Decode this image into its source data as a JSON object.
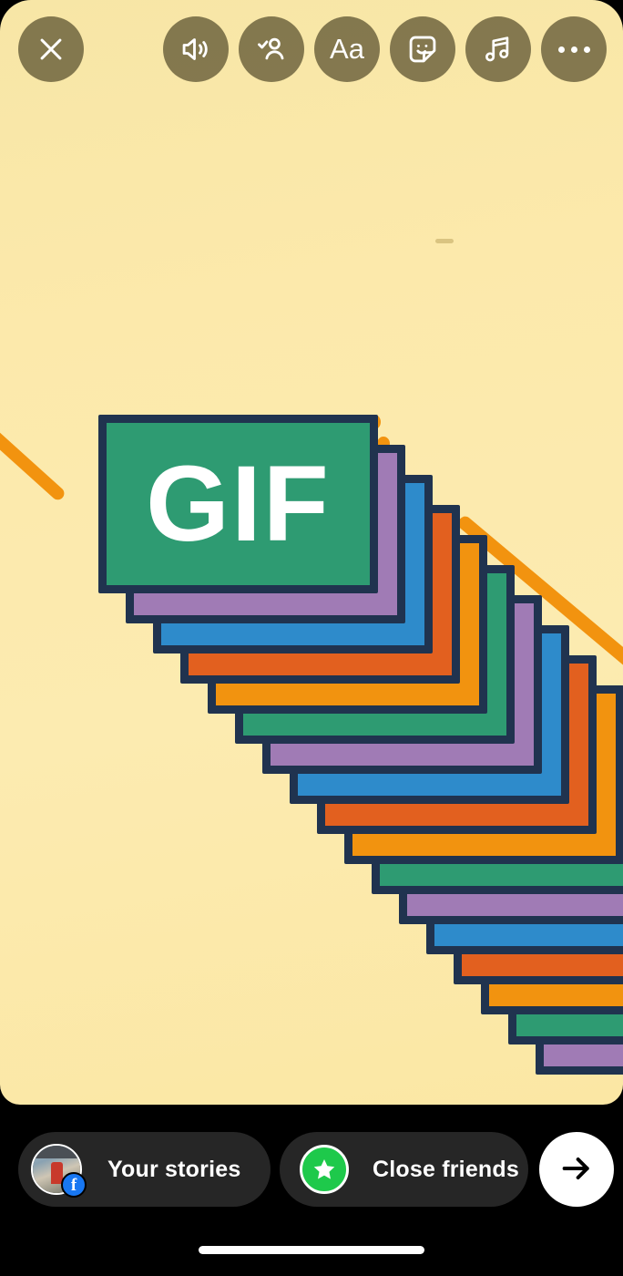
{
  "screen": {
    "app": "Instagram Stories Editor",
    "background_color": "#fbe9ab",
    "bottom_bar_color": "#000000"
  },
  "toolbar": {
    "buttons": [
      {
        "name": "close-button",
        "icon": "close-icon",
        "label": "Close"
      },
      {
        "name": "sound-button",
        "icon": "speaker-on-icon",
        "label": "Sound on"
      },
      {
        "name": "tag-people-button",
        "icon": "person-check-icon",
        "label": "Tag people"
      },
      {
        "name": "text-button",
        "icon": "text-icon",
        "label": "Aa"
      },
      {
        "name": "sticker-button",
        "icon": "sticker-icon",
        "label": "Stickers"
      },
      {
        "name": "music-button",
        "icon": "music-note-icon",
        "label": "Music"
      },
      {
        "name": "more-button",
        "icon": "more-dots-icon",
        "label": "More"
      }
    ],
    "text_tool_label": "Aa",
    "button_bg": "rgba(60,52,24,0.62)"
  },
  "sticker": {
    "label": "GIF",
    "card_colors": [
      "#2e9b72",
      "#a07bb5",
      "#2e8bcb",
      "#e2601f",
      "#f2930f"
    ],
    "border_color": "#20334f",
    "text_color": "#ffffff",
    "count": 17
  },
  "confetti": {
    "color": "#f2930f",
    "streaks": 3,
    "sparkles": 4
  },
  "bottom_bar": {
    "your_stories": {
      "label": "Your stories",
      "badge": "facebook-badge",
      "badge_glyph": "f",
      "badge_color": "#1877f2"
    },
    "close_friends": {
      "label": "Close friends",
      "badge": "green-star-badge",
      "badge_color": "#1ec94b"
    },
    "send_button": {
      "label": "Send",
      "icon": "arrow-right-icon",
      "background": "#ffffff"
    }
  }
}
